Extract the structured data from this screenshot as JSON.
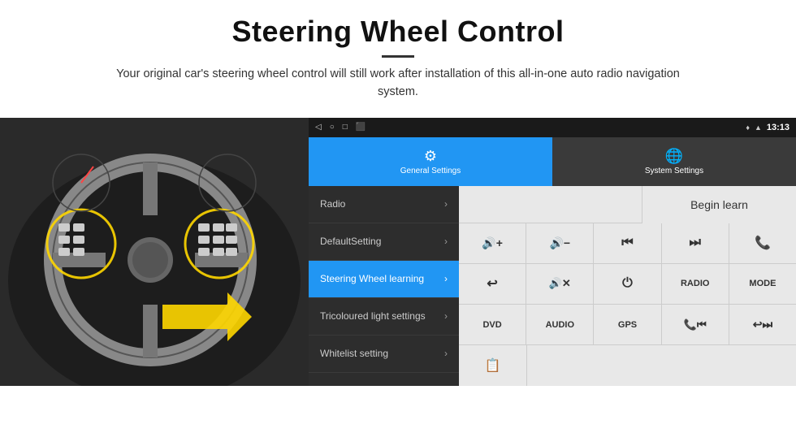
{
  "header": {
    "title": "Steering Wheel Control",
    "subtitle": "Your original car's steering wheel control will still work after installation of this all-in-one auto radio navigation system."
  },
  "statusbar": {
    "time": "13:13"
  },
  "tabs": {
    "general": "General Settings",
    "system": "System Settings"
  },
  "menu": [
    {
      "id": "radio",
      "label": "Radio",
      "active": false
    },
    {
      "id": "default-setting",
      "label": "DefaultSetting",
      "active": false
    },
    {
      "id": "steering-wheel",
      "label": "Steering Wheel learning",
      "active": true
    },
    {
      "id": "tricoloured",
      "label": "Tricoloured light settings",
      "active": false
    },
    {
      "id": "whitelist",
      "label": "Whitelist setting",
      "active": false
    }
  ],
  "controls": {
    "begin_learn": "Begin learn",
    "rows": [
      [
        "vol+",
        "vol-",
        "prev",
        "next",
        "phone"
      ],
      [
        "back",
        "mute",
        "power",
        "RADIO",
        "MODE"
      ],
      [
        "DVD",
        "AUDIO",
        "GPS",
        "phonehold",
        "fastfwd"
      ]
    ]
  }
}
